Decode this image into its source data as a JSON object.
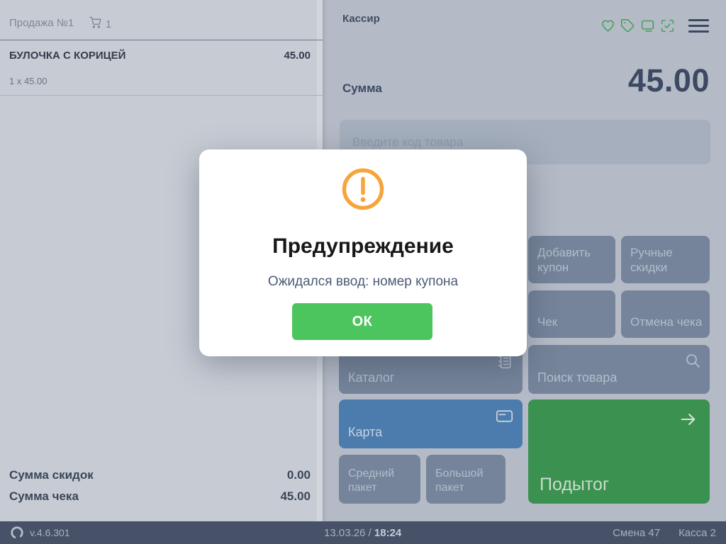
{
  "left_panel": {
    "sale_title": "Продажа №1",
    "cart_count": "1",
    "item": {
      "name": "БУЛОЧКА С КОРИЦЕЙ",
      "price": "45.00",
      "qty": "1 x 45.00"
    },
    "totals": [
      {
        "label": "Сумма скидок",
        "value": "0.00"
      },
      {
        "label": "Сумма чека",
        "value": "45.00"
      }
    ]
  },
  "right_panel": {
    "cashier_label": "Кассир",
    "header_icons": [
      "heart-icon",
      "tag-icon",
      "monitor-icon",
      "scan-check-icon",
      "menu-icon"
    ],
    "sum_label": "Сумма",
    "sum_value": "45.00",
    "input_placeholder": "Введите код товара",
    "buttons": {
      "add_coupon": "Добавить купон",
      "manual_discounts": "Ручные скидки",
      "receipt": "Чек",
      "cancel_receipt": "Отмена чека",
      "catalog": "Каталог",
      "search_product": "Поиск товара",
      "card": "Карта",
      "subtotal": "Подытог",
      "medium_bag": "Средний пакет",
      "big_bag": "Большой пакет"
    }
  },
  "modal": {
    "title": "Предупреждение",
    "message": "Ожидался ввод: номер купона",
    "ok_label": "ОК",
    "icon": "warning-circle-icon"
  },
  "status_bar": {
    "version": "v.4.6.301",
    "date": "13.03.26",
    "separator": " / ",
    "time": "18:24",
    "shift": "Смена 47",
    "register": "Касса 2"
  },
  "colors": {
    "accent_green": "#4cc55e",
    "warning_orange": "#f7a43c",
    "button_gray": "#75849a",
    "card_blue": "#4c7cad",
    "subtotal_green": "#3a9150",
    "header_icon_green": "#44a05b",
    "statusbar_dark": "#475269"
  }
}
